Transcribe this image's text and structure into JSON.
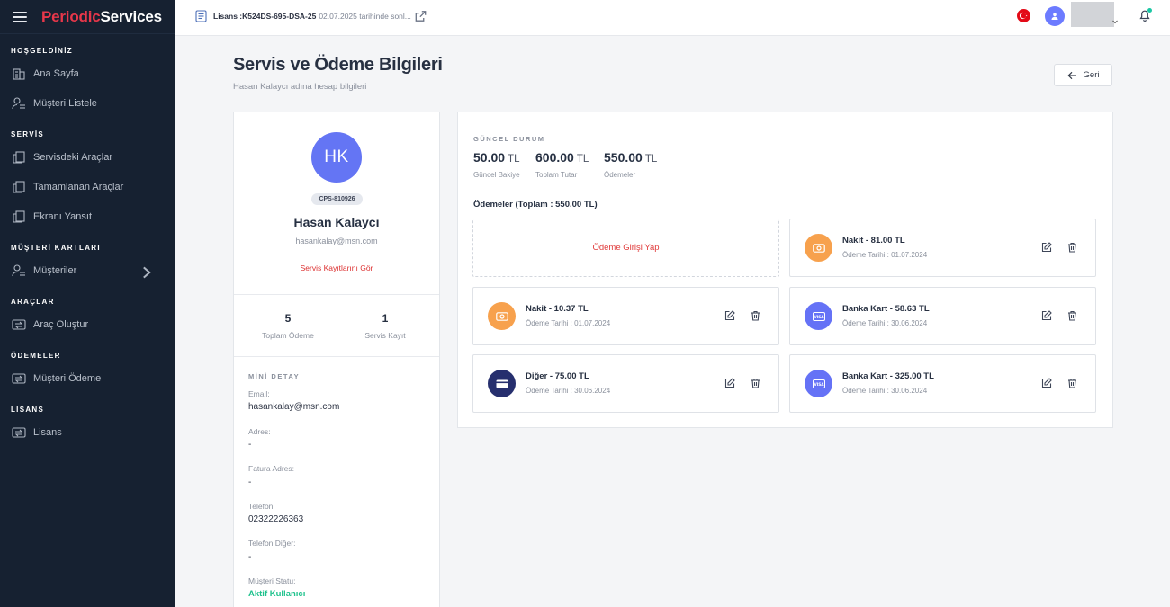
{
  "brand": {
    "part1": "Periodic",
    "part2": "Services"
  },
  "sidebar": {
    "sections": [
      {
        "title": "HOŞGELDİNİZ",
        "items": [
          {
            "label": "Ana Sayfa",
            "icon": "building-icon"
          },
          {
            "label": "Müşteri Listele",
            "icon": "user-list-icon"
          }
        ]
      },
      {
        "title": "SERVİS",
        "items": [
          {
            "label": "Servisdeki Araçlar",
            "icon": "documents-icon"
          },
          {
            "label": "Tamamlanan Araçlar",
            "icon": "documents-icon"
          },
          {
            "label": "Ekranı Yansıt",
            "icon": "documents-icon"
          }
        ]
      },
      {
        "title": "MÜŞTERİ KARTLARI",
        "items": [
          {
            "label": "Müşteriler",
            "icon": "user-list-icon",
            "has_chevron": true
          }
        ]
      },
      {
        "title": "ARAÇLAR",
        "items": [
          {
            "label": "Araç Oluştur",
            "icon": "swap-icon"
          }
        ]
      },
      {
        "title": "ÖDEMELER",
        "items": [
          {
            "label": "Müşteri Ödeme",
            "icon": "swap-icon"
          }
        ]
      },
      {
        "title": "LİSANS",
        "items": [
          {
            "label": "Lisans",
            "icon": "swap-icon"
          }
        ]
      }
    ]
  },
  "topbar": {
    "license_key": "Lisans :K524DS-695-DSA-25",
    "license_date": "02.07.2025 tarihinde sonl...",
    "notification_dot_color": "#1bc7a4"
  },
  "header": {
    "title": "Servis ve Ödeme Bilgileri",
    "subtitle": "Hasan Kalaycı adına hesap bilgileri",
    "back_label": "Geri"
  },
  "profile": {
    "initials": "HK",
    "code": "CPS-810926",
    "name": "Hasan Kalaycı",
    "email": "hasankalay@msn.com",
    "service_link": "Servis Kayıtlarını Gör",
    "stats": [
      {
        "value": "5",
        "label": "Toplam Ödeme"
      },
      {
        "value": "1",
        "label": "Servis Kayıt"
      }
    ],
    "mini_title": "MİNİ DETAY",
    "details": [
      {
        "label": "Email:",
        "value": "hasankalay@msn.com"
      },
      {
        "label": "Adres:",
        "value": "-"
      },
      {
        "label": "Fatura Adres:",
        "value": "-"
      },
      {
        "label": "Telefon:",
        "value": "02322226363"
      },
      {
        "label": "Telefon Diğer:",
        "value": "-"
      },
      {
        "label": "Müşteri Statu:",
        "value": "Aktif Kullanıcı"
      }
    ]
  },
  "status": {
    "title": "GÜNCEL DURUM",
    "metrics": [
      {
        "value": "50.00",
        "unit": "TL",
        "label": "Güncel Bakiye"
      },
      {
        "value": "600.00",
        "unit": "TL",
        "label": "Toplam Tutar"
      },
      {
        "value": "550.00",
        "unit": "TL",
        "label": "Ödemeler"
      }
    ],
    "payments_title": "Ödemeler (Toplam : 550.00 TL)",
    "add_payment": "Ödeme Girişi Yap",
    "payments": [
      {
        "title": "Nakit - 81.00 TL",
        "date": "Ödeme Tarihi : 01.07.2024",
        "type": "cash",
        "color": "#f7a14d"
      },
      {
        "title": "Nakit - 10.37 TL",
        "date": "Ödeme Tarihi : 01.07.2024",
        "type": "cash",
        "color": "#f7a14d"
      },
      {
        "title": "Banka Kart - 58.63 TL",
        "date": "Ödeme Tarihi : 30.06.2024",
        "type": "visa",
        "color": "#6572f6"
      },
      {
        "title": "Diğer - 75.00 TL",
        "date": "Ödeme Tarihi : 30.06.2024",
        "type": "card",
        "color": "#262f6e"
      },
      {
        "title": "Banka Kart - 325.00 TL",
        "date": "Ödeme Tarihi : 30.06.2024",
        "type": "visa",
        "color": "#6572f6"
      }
    ]
  }
}
